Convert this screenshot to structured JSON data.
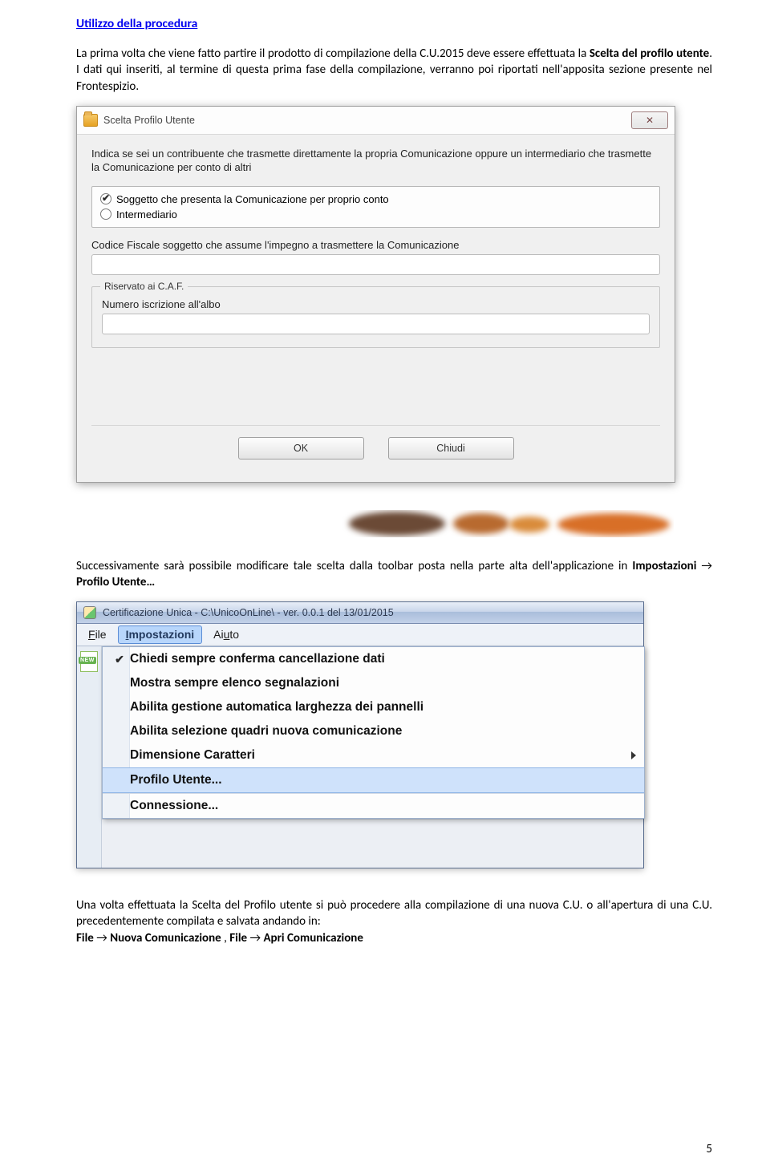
{
  "section_title": "Utilizzo della procedura",
  "intro": {
    "p1_a": "La prima volta che viene fatto partire il prodotto di compilazione della C.U.2015 deve essere effettuata la ",
    "p1_b": "Scelta del profilo utente",
    "p1_c": ". I dati qui inseriti, al termine di questa prima fase della compilazione, verranno poi riportati nell'apposita sezione presente nel Frontespizio."
  },
  "dialog1": {
    "title": "Scelta Profilo Utente",
    "close_icon": "✕",
    "instructions": "Indica se sei un contribuente che trasmette direttamente la propria Comunicazione oppure un intermediario che trasmette la Comunicazione per conto di altri",
    "radio": {
      "opt1": "Soggetto che presenta la Comunicazione per proprio conto",
      "opt2": "Intermediario",
      "selected": 1
    },
    "cf_label": "Codice Fiscale soggetto che assume l'impegno a trasmettere la Comunicazione",
    "cf_value": "",
    "caf_legend": "Riservato ai C.A.F.",
    "albo_label": "Numero iscrizione all'albo",
    "albo_value": "",
    "ok_label": "OK",
    "chiudi_label": "Chiudi"
  },
  "para2": {
    "a": "Successivamente sarà possibile modificare tale scelta dalla toolbar posta nella parte alta dell'applicazione in ",
    "imp": "Impostazioni",
    "arrow": " → ",
    "pu": "   Profilo Utente…"
  },
  "app": {
    "title": "Certificazione Unica - C:\\UnicoOnLine\\  -  ver. 0.0.1 del 13/01/2015",
    "menu": {
      "file": "File",
      "impostazioni": "Impostazioni",
      "aiuto": "Aiuto"
    },
    "dropdown": [
      {
        "label": "Chiedi sempre conferma cancellazione dati",
        "checked": true
      },
      {
        "label": "Mostra sempre elenco segnalazioni",
        "checked": false
      },
      {
        "label": "Abilita gestione automatica larghezza dei pannelli",
        "checked": false
      },
      {
        "label": "Abilita selezione quadri nuova comunicazione",
        "checked": false
      },
      {
        "label": "Dimensione Caratteri",
        "submenu": true
      },
      {
        "label": "Profilo Utente...",
        "highlight": true,
        "sep_before": true
      },
      {
        "label": "Connessione...",
        "sep_before": true
      }
    ]
  },
  "para3": {
    "a": "Una volta effettuata la Scelta del Profilo utente si può procedere alla compilazione di una nuova C.U. o all'apertura di una C.U. precedentemente compilata e salvata andando in:",
    "line2_a": "File",
    "arrow": " → ",
    "line2_b": "   Nuova Comunicazione ",
    "line2_c": ", ",
    "line2_d": "File",
    "line2_e": "   Apri Comunicazione"
  },
  "page_number": "5"
}
